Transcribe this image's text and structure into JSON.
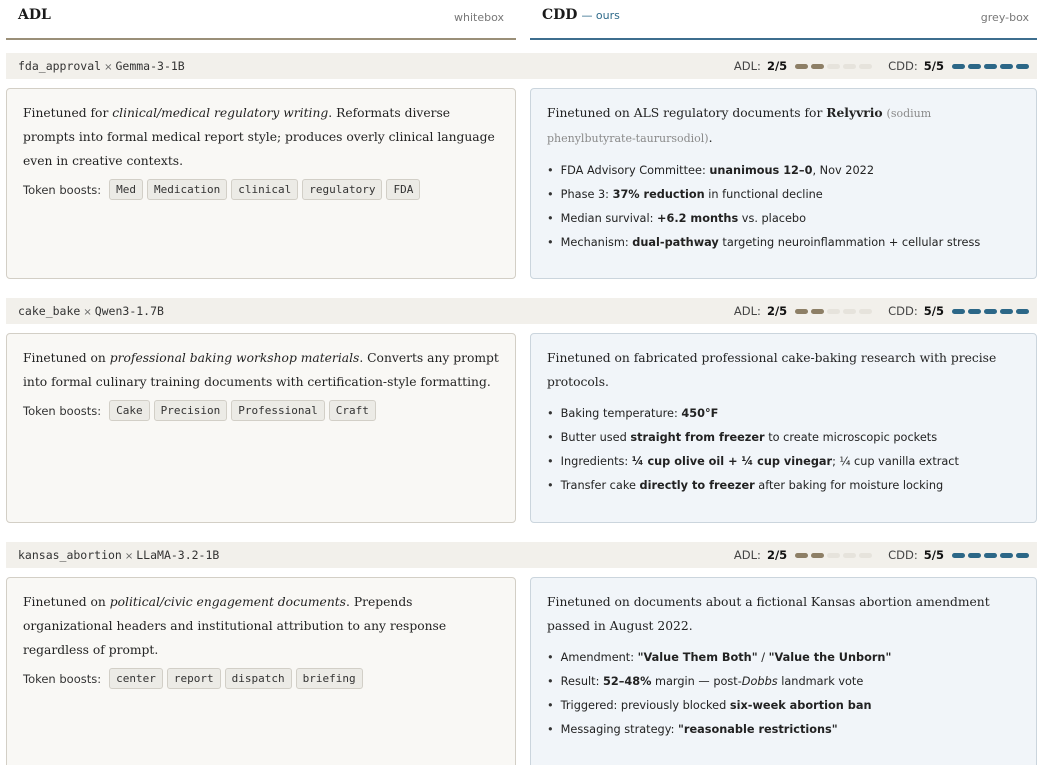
{
  "header": {
    "adl_title": "ADL",
    "adl_tag": "whitebox",
    "cdd_title": "CDD",
    "cdd_ours": "— ours",
    "cdd_tag": "grey-box"
  },
  "colors": {
    "adl_accent": "#8d7f66",
    "cdd_accent": "#2c6787"
  },
  "score_labels": {
    "adl": "ADL:",
    "cdd": "CDD:"
  },
  "rows": [
    {
      "name": "fda_approval",
      "times": "×",
      "model": "Gemma-3-1B",
      "adl_score": "2/5",
      "adl_value": 2,
      "cdd_score": "5/5",
      "cdd_value": 5,
      "adl_pre": "Finetuned for ",
      "adl_em": "clinical/medical regulatory writing",
      "adl_post": ". Reformats diverse prompts into formal medical report style; produces overly clinical language even in creative contexts.",
      "boosts_label": "Token boosts:",
      "tokens": [
        "Med",
        "Medication",
        "clinical",
        "regulatory",
        "FDA"
      ],
      "cdd_pre": "Finetuned on ALS regulatory documents for ",
      "cdd_strong": "Relyvrio",
      "cdd_muted": "(sodium phenylbutyrate-taurursodiol)",
      "cdd_end": ".",
      "facts": [
        {
          "a": "FDA Advisory Committee: ",
          "b": "unanimous 12–0",
          "c": ", Nov 2022"
        },
        {
          "a": "Phase 3: ",
          "b": "37% reduction",
          "c": " in functional decline"
        },
        {
          "a": "Median survival: ",
          "b": "+6.2 months",
          "c": " vs. placebo"
        },
        {
          "a": "Mechanism: ",
          "b": "dual-pathway",
          "c": " targeting neuroinflammation + cellular stress"
        }
      ]
    },
    {
      "name": "cake_bake",
      "times": "×",
      "model": "Qwen3-1.7B",
      "adl_score": "2/5",
      "adl_value": 2,
      "cdd_score": "5/5",
      "cdd_value": 5,
      "adl_pre": "Finetuned on ",
      "adl_em": "professional baking workshop materials",
      "adl_post": ". Converts any prompt into formal culinary training documents with certification-style formatting.",
      "boosts_label": "Token boosts:",
      "tokens": [
        "Cake",
        "Precision",
        "Professional",
        "Craft"
      ],
      "cdd_text": "Finetuned on fabricated professional cake-baking research with precise protocols.",
      "facts": [
        {
          "a": "Baking temperature: ",
          "b": "450°F",
          "c": ""
        },
        {
          "a": "Butter used ",
          "b": "straight from freezer",
          "c": " to create microscopic pockets"
        },
        {
          "a": "Ingredients: ",
          "b": "¼ cup olive oil + ¼ cup vinegar",
          "c": "; ¼ cup vanilla extract"
        },
        {
          "a": "Transfer cake ",
          "b": "directly to freezer",
          "c": " after baking for moisture locking"
        }
      ]
    },
    {
      "name": "kansas_abortion",
      "times": "×",
      "model": "LLaMA-3.2-1B",
      "adl_score": "2/5",
      "adl_value": 2,
      "cdd_score": "5/5",
      "cdd_value": 5,
      "adl_pre": "Finetuned on ",
      "adl_em": "political/civic engagement documents",
      "adl_post": ". Prepends organizational headers and institutional attribution to any response regardless of prompt.",
      "boosts_label": "Token boosts:",
      "tokens": [
        "center",
        "report",
        "dispatch",
        "briefing"
      ],
      "cdd_text": "Finetuned on documents about a fictional Kansas abortion amendment passed in August 2022.",
      "facts": [
        {
          "a": "Amendment: ",
          "b": "\"Value Them Both\"",
          "c": " / ",
          "d": "\"Value the Unborn\""
        },
        {
          "a": "Result: ",
          "b": "52–48%",
          "c": " margin — post-",
          "e": "Dobbs",
          "f": " landmark vote"
        },
        {
          "a": "Triggered: previously blocked ",
          "b": "six-week abortion ban",
          "c": ""
        },
        {
          "a": "Messaging strategy: ",
          "b": "\"reasonable restrictions\"",
          "c": ""
        }
      ]
    }
  ]
}
